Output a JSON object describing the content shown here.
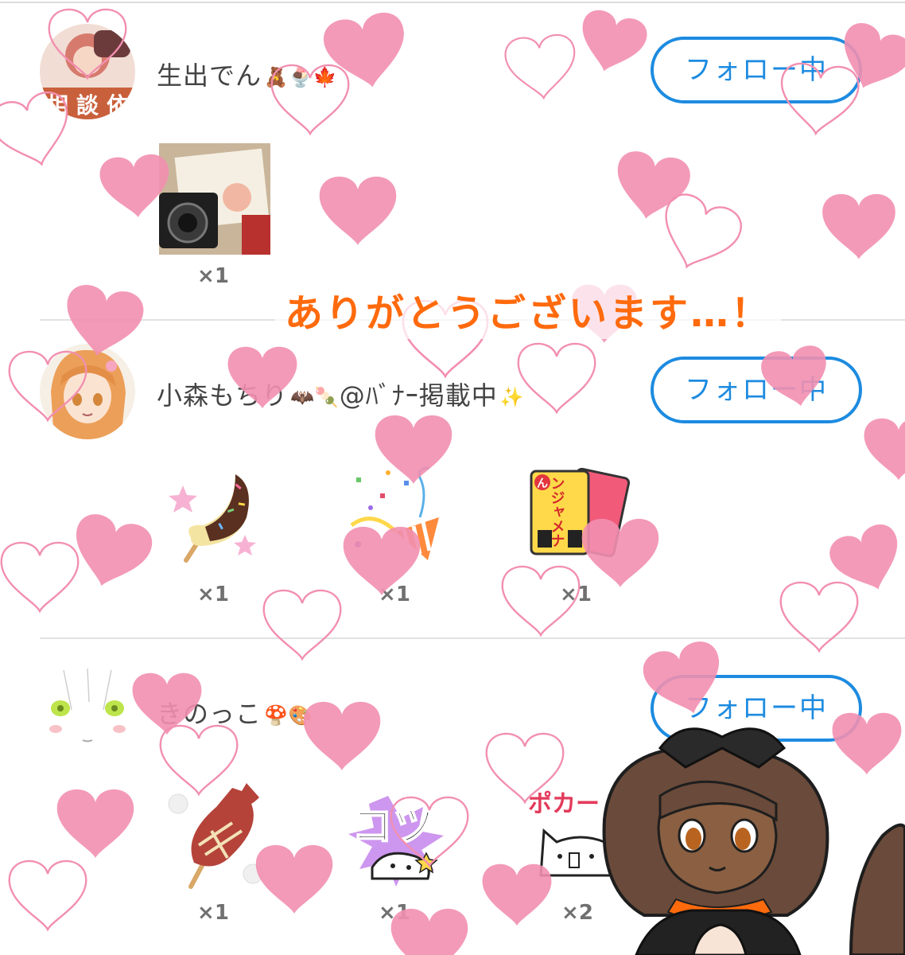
{
  "overlay": {
    "caption": "ありがとうございます…！"
  },
  "users": [
    {
      "name": "生出でん",
      "emoji": "🧸🍨🍁",
      "avatar_text": [
        "相",
        "談",
        "依"
      ],
      "follow_label": "フォロー中",
      "gifts": [
        {
          "icon": "camera-photo-gift",
          "count": "×1"
        }
      ]
    },
    {
      "name": "小森もちり",
      "emoji": "🦇🍡",
      "name_suffix": "@ﾊﾞﾅｰ掲載中",
      "suffix_emoji": "✨",
      "follow_label": "フォロー中",
      "gifts": [
        {
          "icon": "choco-banana-gift",
          "count": "×1"
        },
        {
          "icon": "party-popper-gift",
          "count": "×1"
        },
        {
          "icon": "cards-gift",
          "count": "×1",
          "label": "ンジャメナ",
          "badge": "ん"
        }
      ]
    },
    {
      "name": "きのっこ",
      "emoji": "🍄🎨",
      "follow_label": "フォロー中",
      "gifts": [
        {
          "icon": "grilled-squid-gift",
          "count": "×1"
        },
        {
          "icon": "kotsu-sticker-gift",
          "count": "×1",
          "label": "コツ"
        },
        {
          "icon": "poker-sticker-gift",
          "count": "×2",
          "label": "ポカー"
        }
      ]
    }
  ],
  "colors": {
    "accent": "#1d8be0",
    "caption": "#ff6a0d",
    "heart": "#f28fb0"
  }
}
